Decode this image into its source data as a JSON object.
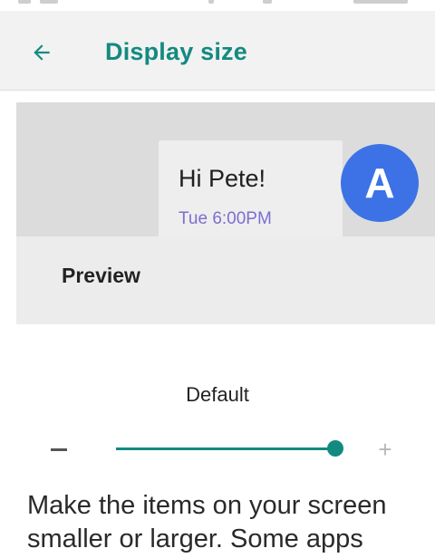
{
  "app_bar": {
    "title": "Display size",
    "accent_color": "#138a80"
  },
  "preview": {
    "message": "Hi Pete!",
    "timestamp": "Tue 6:00PM",
    "avatar_letter": "A",
    "avatar_color": "#3d72e6",
    "label": "Preview"
  },
  "size": {
    "current_label": "Default",
    "slider_level": 1.0
  },
  "description": {
    "line1": "Make the items on your screen",
    "line2": "smaller or larger. Some apps"
  }
}
